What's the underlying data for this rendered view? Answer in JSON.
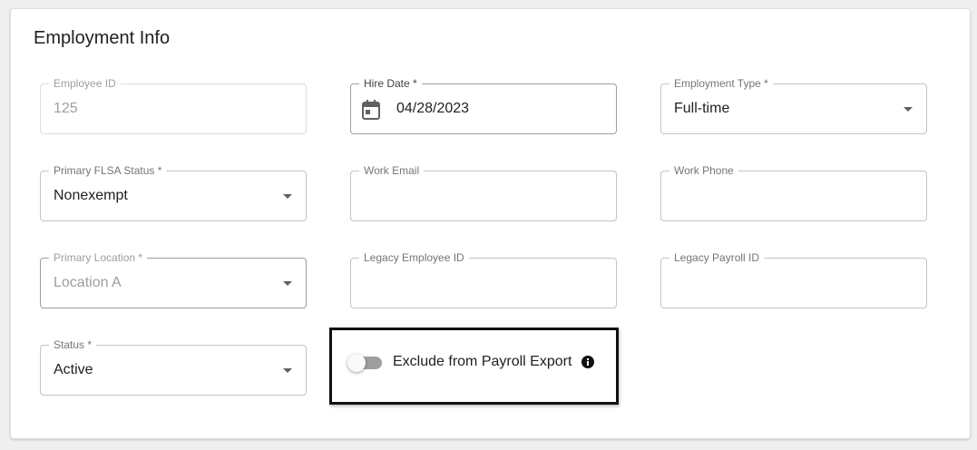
{
  "section": {
    "title": "Employment Info"
  },
  "fields": {
    "employee_id": {
      "label": "Employee ID",
      "value": "125"
    },
    "hire_date": {
      "label": "Hire Date *",
      "value": "04/28/2023"
    },
    "employment_type": {
      "label": "Employment Type *",
      "value": "Full-time"
    },
    "flsa_status": {
      "label": "Primary FLSA Status *",
      "value": "Nonexempt"
    },
    "work_email": {
      "label": "Work Email",
      "value": ""
    },
    "work_phone": {
      "label": "Work Phone",
      "value": ""
    },
    "primary_location": {
      "label": "Primary Location *",
      "value": "Location A"
    },
    "legacy_employee_id": {
      "label": "Legacy Employee ID",
      "value": ""
    },
    "legacy_payroll_id": {
      "label": "Legacy Payroll ID",
      "value": ""
    },
    "status": {
      "label": "Status *",
      "value": "Active"
    }
  },
  "payroll_export_toggle": {
    "label": "Exclude from Payroll Export",
    "checked": false,
    "icon": "info-icon"
  },
  "icons": {
    "calendar": "calendar-icon",
    "dropdown": "chevron-down-icon",
    "info": "info-icon"
  },
  "colors": {
    "card_background": "#ffffff",
    "page_background": "#efefef",
    "field_border": "#c4c4c4",
    "toggle_track_off": "#9e9e9e",
    "highlight_border": "#111111"
  }
}
